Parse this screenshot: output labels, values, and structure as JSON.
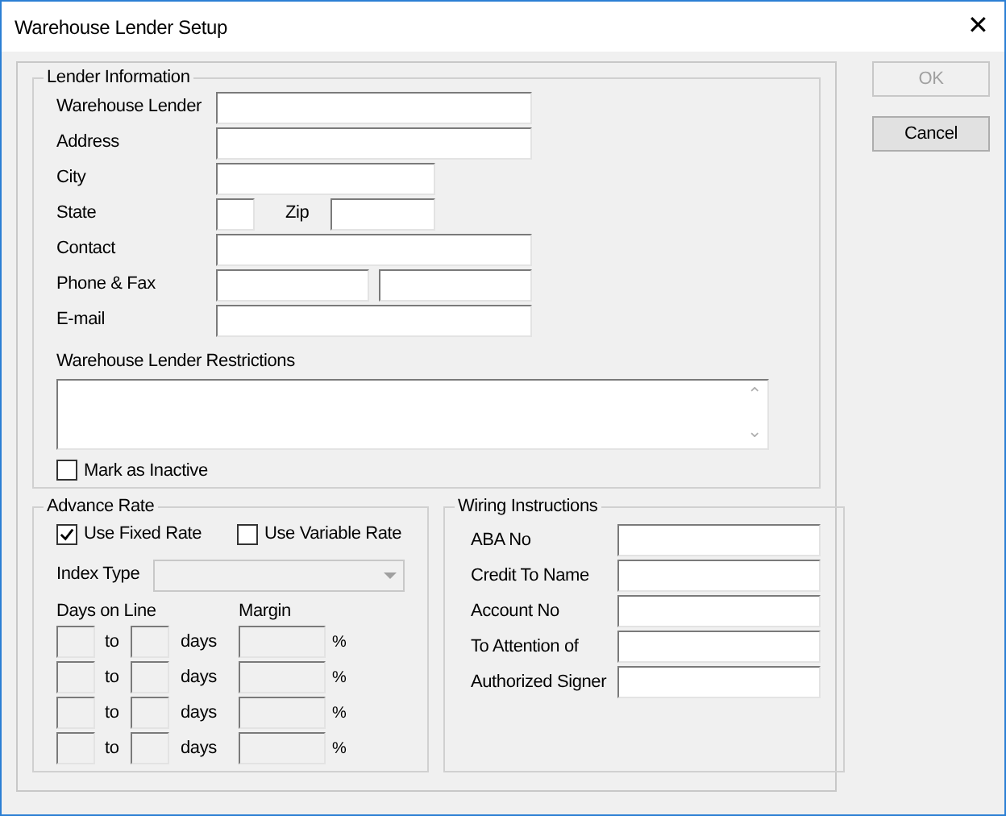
{
  "window": {
    "title": "Warehouse Lender Setup",
    "close": "✕"
  },
  "lender_information": {
    "title": "Lender Information",
    "fields": [
      {
        "kind": "long",
        "label": "Warehouse Lender"
      },
      {
        "kind": "long",
        "label": "Address"
      },
      {
        "kind": "medium",
        "label": "City"
      },
      {
        "kind": "state_zip",
        "label": "State",
        "second_label": "Zip"
      },
      {
        "kind": "long",
        "label": "Contact"
      },
      {
        "kind": "pair",
        "label": "Phone & Fax"
      },
      {
        "kind": "long",
        "label": "E-mail"
      }
    ],
    "restrictions": {
      "label": "Warehouse Lender Restrictions",
      "scroll_up": "⌃",
      "scroll_down": "⌄"
    },
    "mark_inactive": {
      "label": "Mark as Inactive",
      "checked": false
    }
  },
  "advance_rate": {
    "title": "Advance Rate",
    "rate_options": [
      {
        "label": "Use Fixed Rate",
        "checked": true
      },
      {
        "label": "Use Variable Rate",
        "checked": false
      }
    ],
    "index_type": {
      "label": "Index Type",
      "disabled": true
    },
    "days_header": "Days on Line",
    "margin_header": "Margin",
    "rows": [
      {
        "to": "to",
        "days": "days",
        "percent": "%",
        "disabled": true
      },
      {
        "to": "to",
        "days": "days",
        "percent": "%",
        "disabled": true
      },
      {
        "to": "to",
        "days": "days",
        "percent": "%",
        "disabled": true
      },
      {
        "to": "to",
        "days": "days",
        "percent": "%",
        "disabled": true
      }
    ]
  },
  "wiring_instructions": {
    "title": "Wiring Instructions",
    "fields": [
      {
        "label": "ABA No"
      },
      {
        "label": "Credit To Name"
      },
      {
        "label": "Account No"
      },
      {
        "label": "To Attention of"
      },
      {
        "label": "Authorized Signer"
      }
    ]
  },
  "buttons": [
    {
      "label": "OK",
      "disabled": true
    },
    {
      "label": "Cancel",
      "disabled": false
    }
  ]
}
